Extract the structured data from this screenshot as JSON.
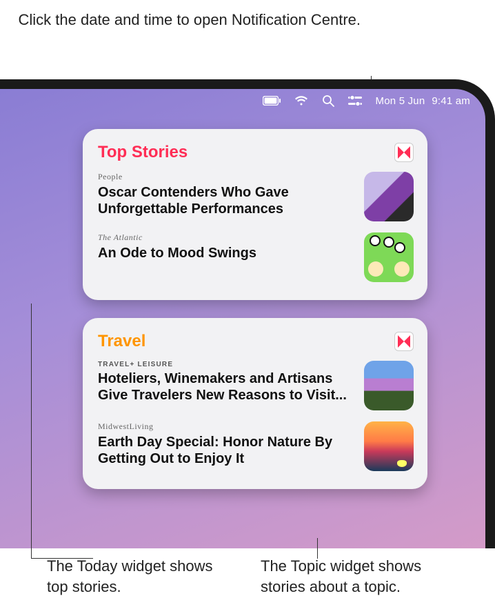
{
  "callouts": {
    "top": "Click the date and time to open Notification Centre.",
    "bottom_left": "The Today widget shows top stories.",
    "bottom_right": "The Topic widget shows stories about a topic."
  },
  "menubar": {
    "date": "Mon 5 Jun",
    "time": "9:41 am"
  },
  "widgets": [
    {
      "title": "Top Stories",
      "title_class": "title-top",
      "stories": [
        {
          "source": "People",
          "source_class": "source",
          "headline": "Oscar Contenders Who Gave Unforgettable Performances",
          "thumb": "thumb1"
        },
        {
          "source": "The Atlantic",
          "source_class": "source italic",
          "headline": "An Ode to Mood Swings",
          "thumb": "thumb2"
        }
      ]
    },
    {
      "title": "Travel",
      "title_class": "title-travel",
      "stories": [
        {
          "source": "TRAVEL+ LEISURE",
          "source_class": "source sans",
          "headline": "Hoteliers, Winemakers and Artisans Give Travelers New Reasons to Visit...",
          "thumb": "thumb3"
        },
        {
          "source": "MidwestLiving",
          "source_class": "source",
          "headline": "Earth Day Special: Honor Nature By Getting Out to Enjoy It",
          "thumb": "thumb4"
        }
      ]
    }
  ]
}
